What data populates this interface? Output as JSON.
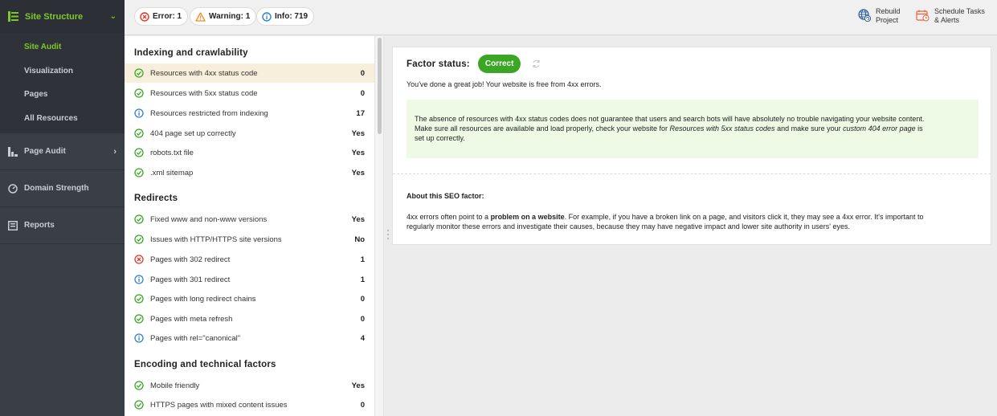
{
  "sidebar": {
    "header": {
      "label": "Site Structure",
      "icon": "site-structure-icon"
    },
    "subitems": [
      {
        "label": "Site Audit",
        "active": true
      },
      {
        "label": "Visualization",
        "active": false
      },
      {
        "label": "Pages",
        "active": false
      },
      {
        "label": "All Resources",
        "active": false
      }
    ],
    "items": [
      {
        "label": "Page Audit",
        "icon": "page-audit-icon",
        "chevron": "›"
      },
      {
        "label": "Domain Strength",
        "icon": "domain-strength-icon"
      },
      {
        "label": "Reports",
        "icon": "reports-icon"
      }
    ]
  },
  "topbar": {
    "error": "Error: 1",
    "warning": "Warning: 1",
    "info": "Info: 719",
    "rebuild": [
      "Rebuild",
      "Project"
    ],
    "schedule": [
      "Schedule Tasks",
      "& Alerts"
    ]
  },
  "factors": {
    "sections": [
      {
        "title": "Indexing and crawlability",
        "rows": [
          {
            "label": "Resources with 4xx status code",
            "value": "0",
            "status": "ok",
            "selected": true
          },
          {
            "label": "Resources with 5xx status code",
            "value": "0",
            "status": "ok"
          },
          {
            "label": "Resources restricted from indexing",
            "value": "17",
            "status": "info"
          },
          {
            "label": "404 page set up correctly",
            "value": "Yes",
            "status": "ok"
          },
          {
            "label": "robots.txt file",
            "value": "Yes",
            "status": "ok"
          },
          {
            "label": ".xml sitemap",
            "value": "Yes",
            "status": "ok"
          }
        ]
      },
      {
        "title": "Redirects",
        "rows": [
          {
            "label": "Fixed www and non-www versions",
            "value": "Yes",
            "status": "ok"
          },
          {
            "label": "Issues with HTTP/HTTPS site versions",
            "value": "No",
            "status": "ok"
          },
          {
            "label": "Pages with 302 redirect",
            "value": "1",
            "status": "error"
          },
          {
            "label": "Pages with 301 redirect",
            "value": "1",
            "status": "info"
          },
          {
            "label": "Pages with long redirect chains",
            "value": "0",
            "status": "ok"
          },
          {
            "label": "Pages with meta refresh",
            "value": "0",
            "status": "ok"
          },
          {
            "label": "Pages with rel=\"canonical\"",
            "value": "4",
            "status": "info"
          }
        ]
      },
      {
        "title": "Encoding and technical factors",
        "rows": [
          {
            "label": "Mobile friendly",
            "value": "Yes",
            "status": "ok"
          },
          {
            "label": "HTTPS pages with mixed content issues",
            "value": "0",
            "status": "ok"
          }
        ]
      }
    ]
  },
  "detail": {
    "factor_status_label": "Factor status:",
    "status": "Correct",
    "message": "You've done a great job! Your website is free from 4xx errors.",
    "note": {
      "line1": "The absence of resources with 4xx status codes does not guarantee that users and search bots will have absolutely no trouble navigating your website content.",
      "line2a": "Make sure all resources are available and load properly, check your website for ",
      "line2b": "Resources with 5xx status codes",
      "line2c": " and make sure your ",
      "line2d": "custom 404 error page",
      "line2e": " is",
      "line3": "set up correctly."
    },
    "about_title": "About this SEO factor:",
    "about": {
      "a": "4xx errors often point to a ",
      "b": "problem on a website",
      "c": ". For example, if you have a broken link on a page, and visitors click it, they may see a 4xx error. It's important to",
      "d": "regularly monitor these errors and investigate their causes, because they may have negative impact and lower site authority in users' eyes."
    }
  },
  "colors": {
    "green": "#3aa624",
    "accent": "#7ec82a",
    "error": "#e0392b",
    "warning": "#f28c28",
    "info": "#2f80d1"
  }
}
